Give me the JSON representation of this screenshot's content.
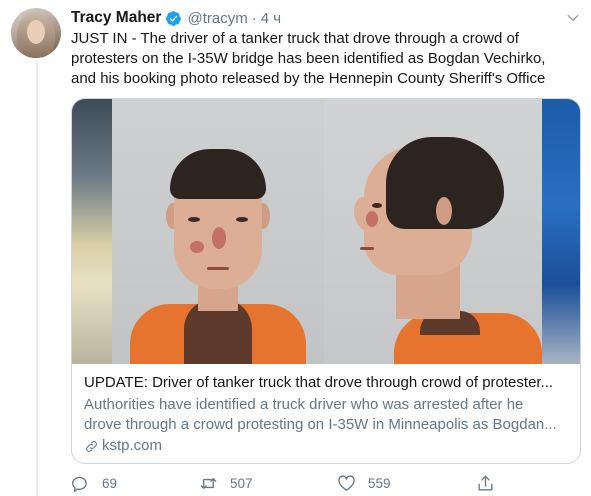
{
  "tweet": {
    "author_name": "Tracy Maher",
    "handle": "@tracym",
    "separator": "·",
    "time": "4 ч",
    "text_lines": [
      "JUST IN - The driver of a tanker truck that drove through a crowd of",
      "protesters on the I-35W bridge has been identified as Bogdan Vechirko,",
      "and his booking photo released by the Hennepin County Sheriff's Office"
    ]
  },
  "card": {
    "title": "UPDATE: Driver of tanker truck that drove through crowd of protester...",
    "description_lines": [
      "Authorities have identified a truck driver who was arrested after he",
      "drove through a crowd protesting on I-35W in Minneapolis as Bogdan..."
    ],
    "domain": "kstp.com"
  },
  "actions": {
    "replies": "69",
    "retweets": "507",
    "likes": "559"
  },
  "icons": {
    "verified": "verified-badge-icon",
    "menu": "chevron-down-icon",
    "link": "link-icon",
    "reply": "reply-icon",
    "retweet": "retweet-icon",
    "like": "heart-icon",
    "share": "share-icon"
  },
  "colors": {
    "verified_blue": "#1da1f2",
    "secondary_text": "#657786",
    "border": "#ccd6dd"
  }
}
